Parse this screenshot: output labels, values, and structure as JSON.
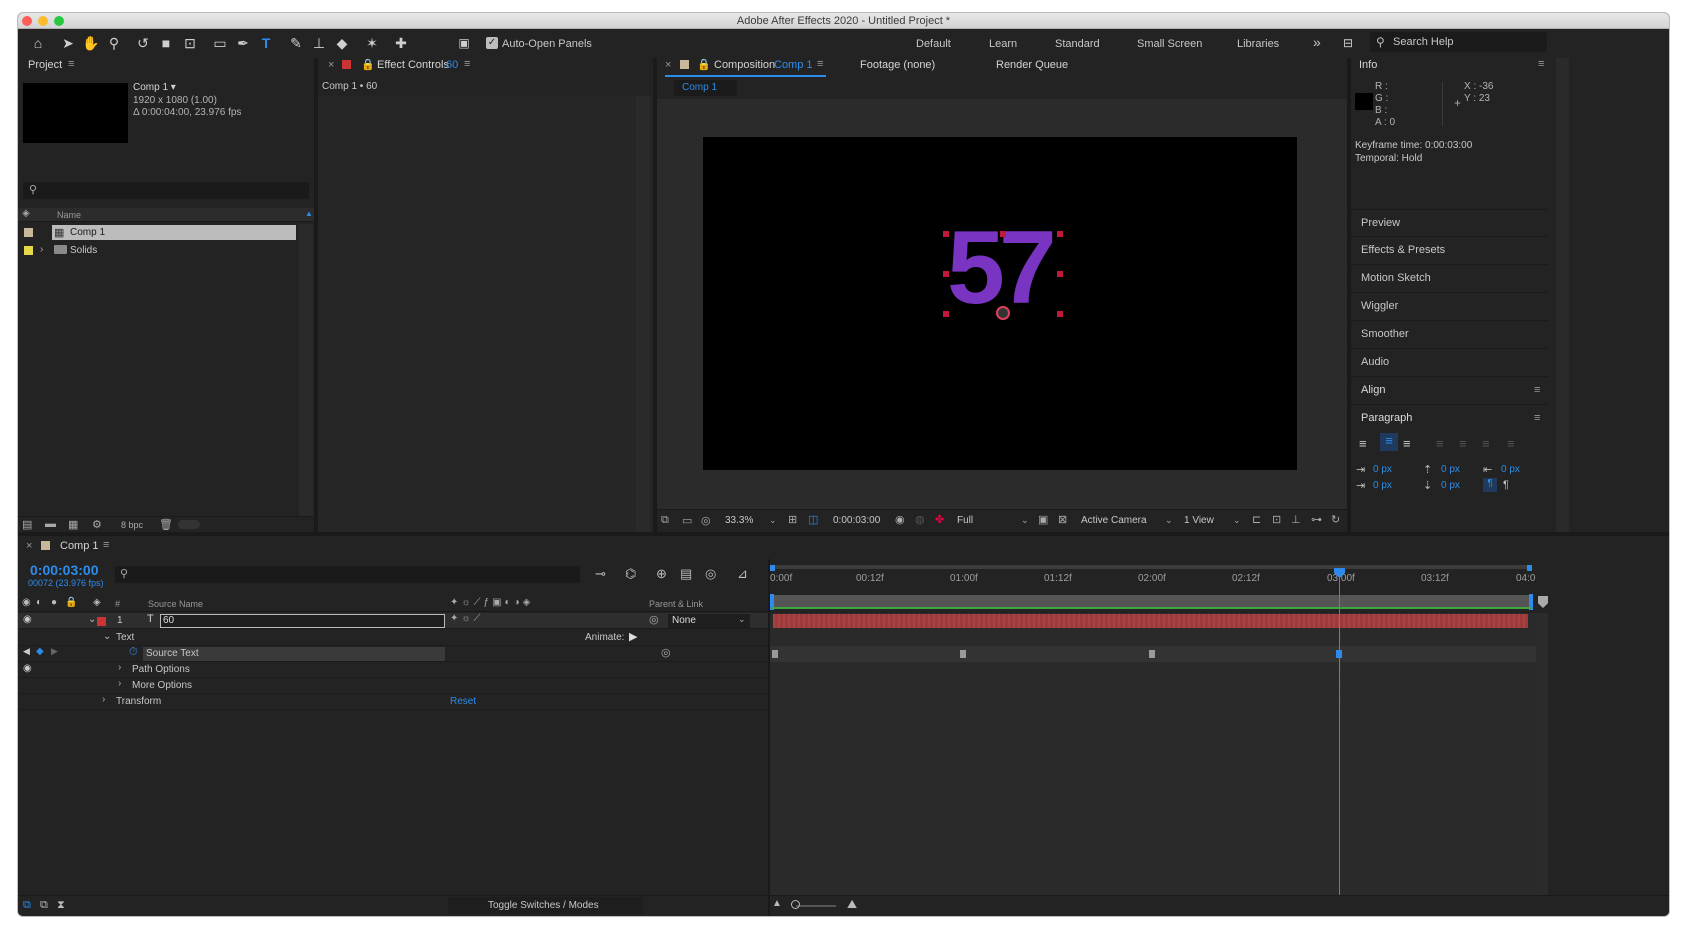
{
  "app": {
    "title": "Adobe After Effects 2020 - Untitled Project *"
  },
  "toolbar": {
    "auto_open_label": "Auto-Open Panels",
    "workspaces": [
      "Default",
      "Learn",
      "Standard",
      "Small Screen",
      "Libraries"
    ],
    "more": "»",
    "search_placeholder": "Search Help"
  },
  "project": {
    "tab": "Project",
    "item_name": "Comp 1 ▾",
    "item_size": "1920 x 1080 (1.00)",
    "item_duration": "Δ 0:00:04:00, 23.976 fps",
    "column_name": "Name",
    "items": [
      {
        "name": "Comp 1",
        "color": "#c9b79c"
      },
      {
        "name": "Solids",
        "color": "#e6d84a"
      }
    ],
    "bpc": "8 bpc"
  },
  "effect_controls": {
    "tab": "Effect Controls",
    "tab_layer": "60",
    "subtitle": "Comp 1 • 60"
  },
  "composition": {
    "tab_prefix": "Composition",
    "tab_name": "Comp 1",
    "footage_tab": "Footage (none)",
    "render_tab": "Render Queue",
    "breadcrumb": "Comp 1",
    "display_text": "57",
    "zoom": "33.3%",
    "timecode": "0:00:03:00",
    "resolution": "Full",
    "camera": "Active Camera",
    "views": "1 View",
    "text_color": "#7a34c2"
  },
  "info": {
    "tab": "Info",
    "r": "R :",
    "g": "G :",
    "b": "B :",
    "a": "A :  0",
    "x": "X : -36",
    "y": "Y : 23",
    "keyframe_time": "Keyframe time: 0:00:03:00",
    "temporal": "Temporal: Hold"
  },
  "side_panels": [
    "Preview",
    "Effects & Presets",
    "Motion Sketch",
    "Wiggler",
    "Smoother",
    "Audio"
  ],
  "align": {
    "tab": "Align"
  },
  "paragraph": {
    "tab": "Paragraph",
    "indent_left": "0 px",
    "indent_right": "0 px",
    "indent_first": "0 px",
    "space_before": "0 px",
    "space_after": "0 px"
  },
  "timeline": {
    "tab": "Comp 1",
    "timecode": "0:00:03:00",
    "frames": "00072 (23.976 fps)",
    "col_num": "#",
    "col_source": "Source Name",
    "col_parent": "Parent & Link",
    "layer_num": "1",
    "layer_name": "60",
    "parent_value": "None",
    "text_group": "Text",
    "animate_label": "Animate:",
    "source_text": "Source Text",
    "path_options": "Path Options",
    "more_options": "More Options",
    "transform": "Transform",
    "reset": "Reset",
    "ruler": [
      "0:00f",
      "00:12f",
      "01:00f",
      "01:12f",
      "02:00f",
      "02:12f",
      "03:00f",
      "03:12f",
      "04:0"
    ],
    "toggle_label": "Toggle Switches / Modes"
  }
}
